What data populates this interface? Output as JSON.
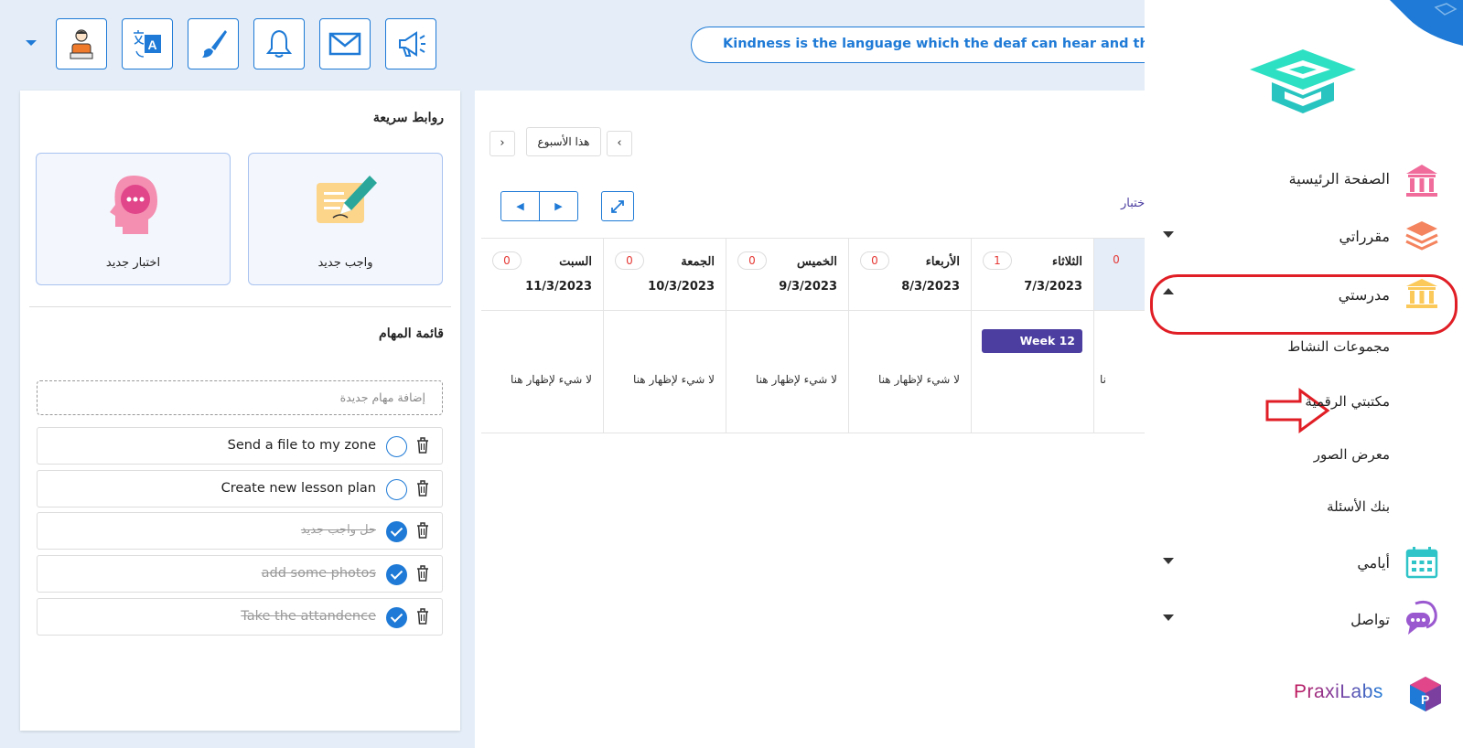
{
  "toolbar": {
    "items": [
      "profile-icon",
      "translate-icon",
      "brush-icon",
      "bell-icon",
      "mail-icon",
      "megaphone-icon"
    ],
    "quote": "Kindness is the language which the deaf can hear and the blind can see."
  },
  "quick_links": {
    "title": "روابط سريعة",
    "new_homework": "واجب جديد",
    "new_quiz": "اختبار جديد"
  },
  "tasks": {
    "title": "قائمة المهام",
    "placeholder": "إضافة مهام جديدة",
    "items": [
      {
        "text": "Send a file to my zone",
        "done": false
      },
      {
        "text": "Create new lesson plan",
        "done": false
      },
      {
        "text": "حل واجب جديد",
        "done": true
      },
      {
        "text": "add some photos",
        "done": true
      },
      {
        "text": "Take the attandence",
        "done": true
      }
    ]
  },
  "calendar": {
    "this_week": "هذا الأسبوع",
    "cut_link": "ختبار",
    "empty_text": "لا شيء لإظهار هنا",
    "week_label": "Week 12",
    "days": [
      {
        "name": "السبت",
        "date": "11/3/2023",
        "count": "0"
      },
      {
        "name": "الجمعة",
        "date": "10/3/2023",
        "count": "0"
      },
      {
        "name": "الخميس",
        "date": "9/3/2023",
        "count": "0"
      },
      {
        "name": "الأربعاء",
        "date": "8/3/2023",
        "count": "0"
      },
      {
        "name": "الثلاثاء",
        "date": "7/3/2023",
        "count": "1"
      },
      {
        "name": "",
        "date": "",
        "count": "0"
      }
    ],
    "partial_empty": "نا"
  },
  "sidebar": {
    "home": "الصفحة الرئيسية",
    "my_courses": "مقرراتي",
    "my_school": "مدرستي",
    "activity_groups": "مجموعات النشاط",
    "digital_library": "مكتبتي الرقمية",
    "photo_gallery": "معرض الصور",
    "question_bank": "بنك الأسئلة",
    "my_days": "أيامي",
    "communicate": "تواصل",
    "brand": "PraxiLabs"
  },
  "colors": {
    "accent": "#1e7ad6",
    "purple": "#4b3ea0",
    "highlight": "#e01e25"
  }
}
